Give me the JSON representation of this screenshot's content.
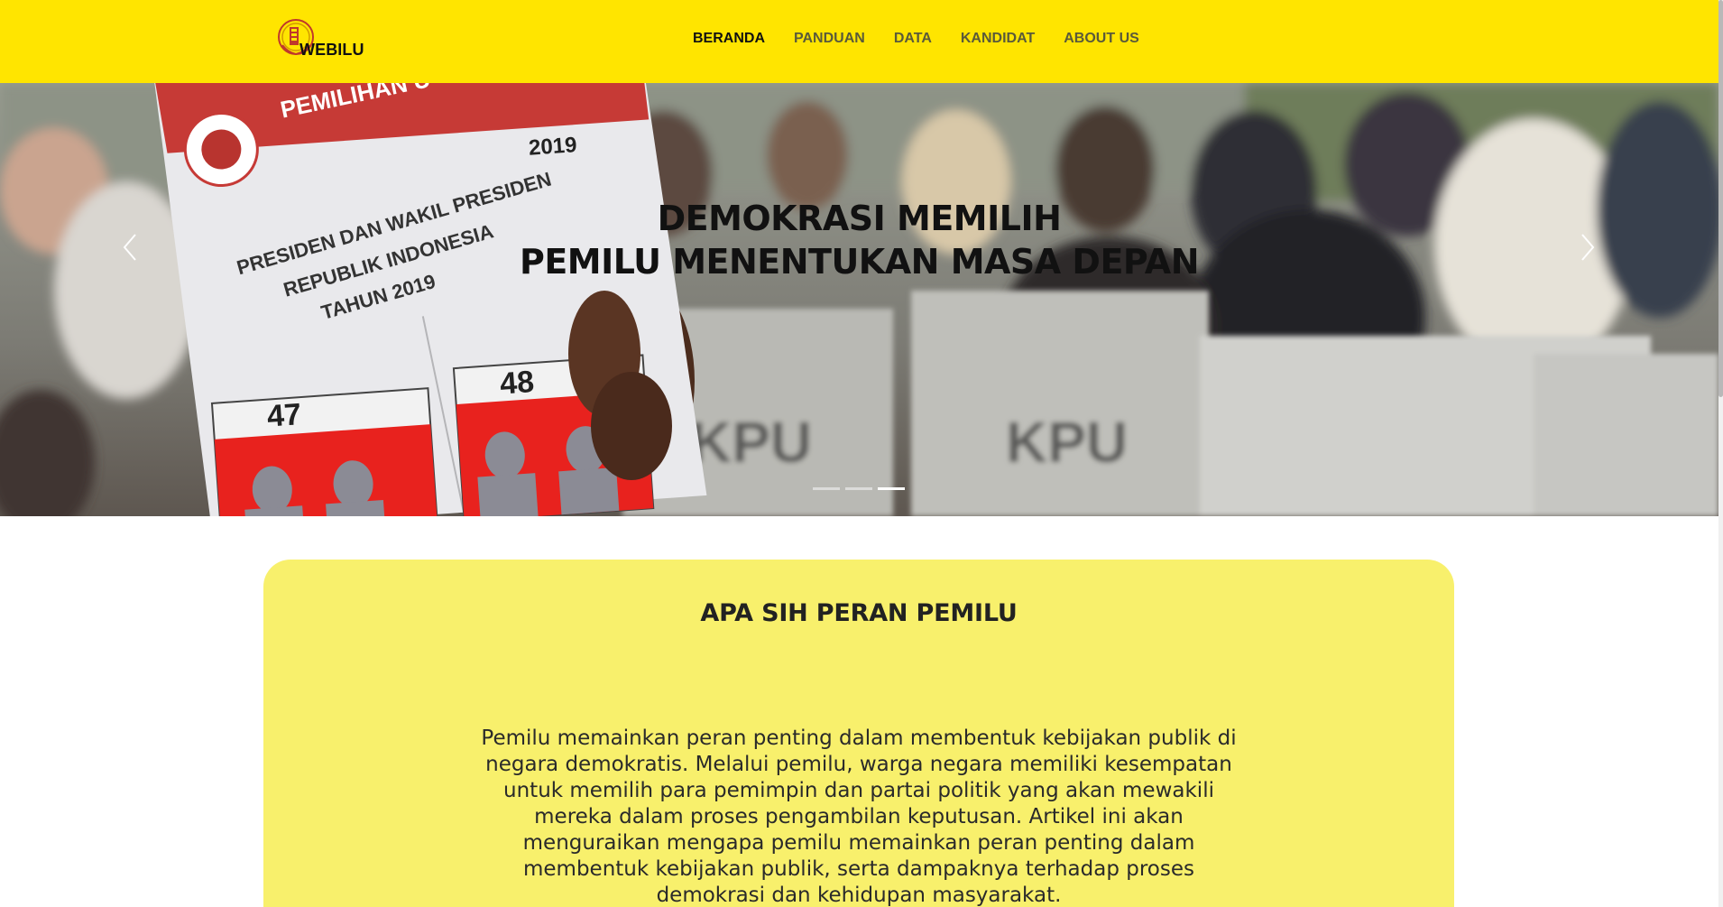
{
  "brand": {
    "name": "WEBILU",
    "logo_icon": "emblem-icon",
    "color_primary": "#ffe500",
    "color_card": "#f8f06c"
  },
  "nav": {
    "items": [
      {
        "label": "BERANDA",
        "active": true
      },
      {
        "label": "PANDUAN",
        "active": false
      },
      {
        "label": "DATA",
        "active": false
      },
      {
        "label": "KANDIDAT",
        "active": false
      },
      {
        "label": "ABOUT US",
        "active": false
      }
    ]
  },
  "hero": {
    "line1": "DEMOKRASI MEMILIH",
    "line2": "PEMILU MENENTUKAN MASA DEPAN",
    "slides_total": 3,
    "active_slide": 3,
    "ballot_text": {
      "header": "PEMILIHAN U",
      "year": "2019",
      "title1": "PRESIDEN DAN WAKIL PRESIDEN",
      "title2": "REPUBLIK INDONESIA",
      "title3": "TAHUN 2019",
      "number_left": "47",
      "number_right": "48",
      "box_label": "KPU"
    }
  },
  "section": {
    "title": "APA SIH PERAN PEMILU",
    "body": "Pemilu memainkan peran penting dalam membentuk kebijakan publik di negara demokratis. Melalui pemilu, warga negara memiliki kesempatan untuk memilih para pemimpin dan partai politik yang akan mewakili mereka dalam proses pengambilan keputusan. Artikel ini akan menguraikan mengapa pemilu memainkan peran penting dalam membentuk kebijakan publik, serta dampaknya terhadap proses demokrasi dan kehidupan masyarakat."
  }
}
